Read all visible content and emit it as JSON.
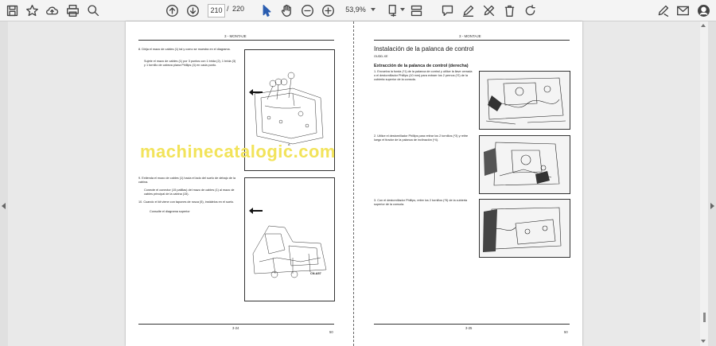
{
  "toolbar": {
    "page_current": "210",
    "page_separator": "/",
    "page_total": "220",
    "zoom": "53,9%"
  },
  "watermark": "machinecatalogic.com",
  "left_page": {
    "header": "3 - MONTAJE",
    "step8": "8.   Dirija el mazo de cables (1) tal y como se muestra en el diagrama.",
    "step8_sub": "Sujete el mazo de cables (1) por 3 puntos con 1 brida (2), 1 brida (3) y 1 tornillo de cabeza plana Phillips (4) en cada punto.",
    "fig_a_label": "A",
    "step9": "9.   Extienda el mazo de cables (1) hacia el lado del suelo de debajo de la cabina.",
    "step9_sub": "Conecte el conector (15 patillas) del mazo de cables (1) al mazo de cables principal de la cabina (15).",
    "step10": "10.  Cuando el kit viene con tapones de rosca (5), instálelos en el suelo.",
    "step10_sub": "Consulte el diagrama superior",
    "fig2_callout": "CN-A57",
    "footer_page": "3-24",
    "footer_code": "50"
  },
  "right_page": {
    "header": "3 - MONTAJE",
    "title": "Instalación de la palanca de control",
    "code": "OUDD-XE",
    "subtitle": "Extracción de la palanca de control (derecha)",
    "step1": "1.   Envuelva la funda (*1) de la palanca de control y utilice la llave cerrada o el destornillador Phillips (10 mm) para extraer los 2 pernos (*2) de la cubierta superior de la consola.",
    "step2": "2.   Utilice el destornillador Phillips para retirar los 2 tornillos (*3) y retire luego el tirador de la palanca de inclinación (*4).",
    "step3": "3.   Con el destornillador Phillips, retire los 2 tornillos (*5) de la cubierta superior de la consola.",
    "footer_page": "3-25",
    "footer_code": "50"
  }
}
